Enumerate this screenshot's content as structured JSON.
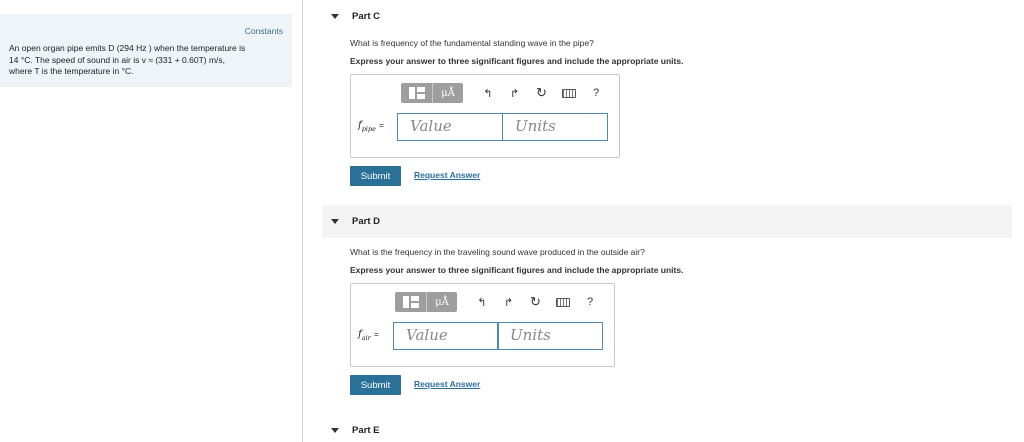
{
  "constants": {
    "title": "Constants",
    "line1": "An open organ pipe emits D (294  Hz ) when the temperature is",
    "line2": "14 °C. The speed of sound in air is v ≈ (331 + 0.60T) m/s,",
    "line3": "where T is the temperature in °C."
  },
  "parts": [
    {
      "label": "Part C",
      "question": "What is frequency of the fundamental standing wave in the pipe?",
      "instruction": "Express your answer to three significant figures and include the appropriate units.",
      "var_main": "f",
      "var_sub": "pipe",
      "equals": "=",
      "value_placeholder": "Value",
      "units_placeholder": "Units",
      "submit": "Submit",
      "request": "Request Answer"
    },
    {
      "label": "Part D",
      "question": "What is the frequency in the traveling sound wave produced in the outside air?",
      "instruction": "Express your answer to three significant figures and include the appropriate units.",
      "var_main": "f",
      "var_sub": "air",
      "equals": "=",
      "value_placeholder": "Value",
      "units_placeholder": "Units",
      "submit": "Submit",
      "request": "Request Answer"
    },
    {
      "label": "Part E"
    }
  ],
  "toolbar": {
    "mu_label": "μÅ",
    "undo": "↰",
    "redo": "↱",
    "reset": "↻",
    "help": "?",
    "icons": [
      "templates-icon",
      "units-mu-icon",
      "undo-icon",
      "redo-icon",
      "reset-icon",
      "keyboard-icon",
      "help-icon"
    ]
  },
  "colors": {
    "panel_bg": "#eef4f8",
    "accent": "#2b7098",
    "link": "#2b6f9f",
    "input_border": "#4d8ab1"
  }
}
